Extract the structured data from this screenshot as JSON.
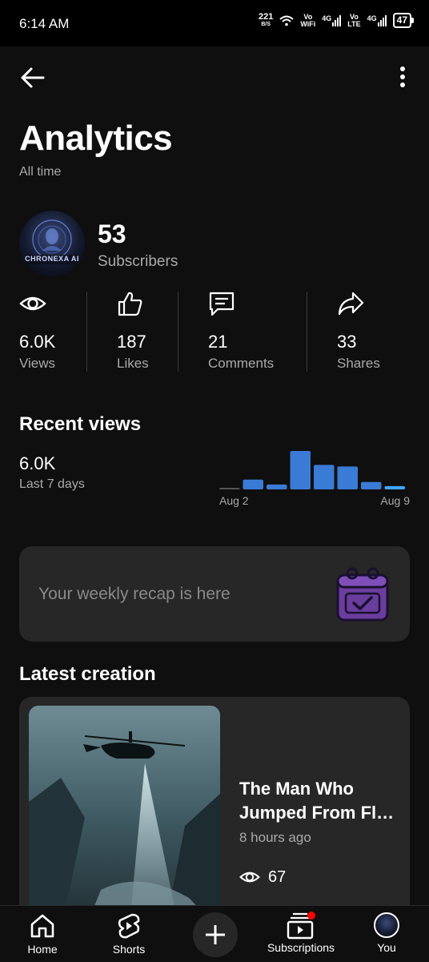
{
  "status_bar": {
    "time": "6:14 AM",
    "speed_top": "221",
    "speed_bottom": "B/S",
    "vo_wifi_top": "Vo",
    "vo_wifi_bottom": "WiFi",
    "net1": "4G",
    "vo_lte_top": "Vo",
    "vo_lte_bottom": "LTE",
    "net2": "4G",
    "battery": "47"
  },
  "header": {
    "back_icon": "arrow-left-icon",
    "more_icon": "more-vert-icon",
    "title": "Analytics",
    "subtitle": "All time"
  },
  "channel": {
    "subscribers_value": "53",
    "subscribers_label": "Subscribers",
    "avatar_text": "CHRONEXA AI"
  },
  "stats": [
    {
      "icon": "eye-icon",
      "value": "6.0K",
      "label": "Views"
    },
    {
      "icon": "thumbs-up-icon",
      "value": "187",
      "label": "Likes"
    },
    {
      "icon": "comment-icon",
      "value": "21",
      "label": "Comments"
    },
    {
      "icon": "share-icon",
      "value": "33",
      "label": "Shares"
    }
  ],
  "recent_views": {
    "title": "Recent views",
    "value": "6.0K",
    "period": "Last 7 days"
  },
  "chart_data": {
    "type": "bar",
    "categories": [
      "Aug 2",
      "",
      "",
      "",
      "",
      "",
      "",
      "Aug 9"
    ],
    "values": [
      1,
      12,
      6,
      47,
      30,
      28,
      9,
      4
    ],
    "highlight_last": true,
    "xlabel": "",
    "ylabel": "",
    "tick_labels": [
      "Aug 2",
      "Aug 9"
    ],
    "colors": {
      "bar": "#3a7bd5",
      "bar_last": "#3ea6ff",
      "bar_zero": "#555555"
    }
  },
  "recap": {
    "text": "Your weekly recap is here",
    "icon": "calendar-check-icon"
  },
  "latest": {
    "title": "Latest creation",
    "video_title": "The Man Who\nJumped From Fl…",
    "time_ago": "8 hours ago",
    "views": "67"
  },
  "bottom_nav": {
    "home": "Home",
    "shorts": "Shorts",
    "subscriptions": "Subscriptions",
    "you": "You"
  },
  "colors": {
    "background": "#0f0f0f",
    "card": "#272727",
    "accent_blue": "#3a7bd5",
    "badge_red": "#ff0000",
    "recap_purple": "#6a3d9e"
  }
}
